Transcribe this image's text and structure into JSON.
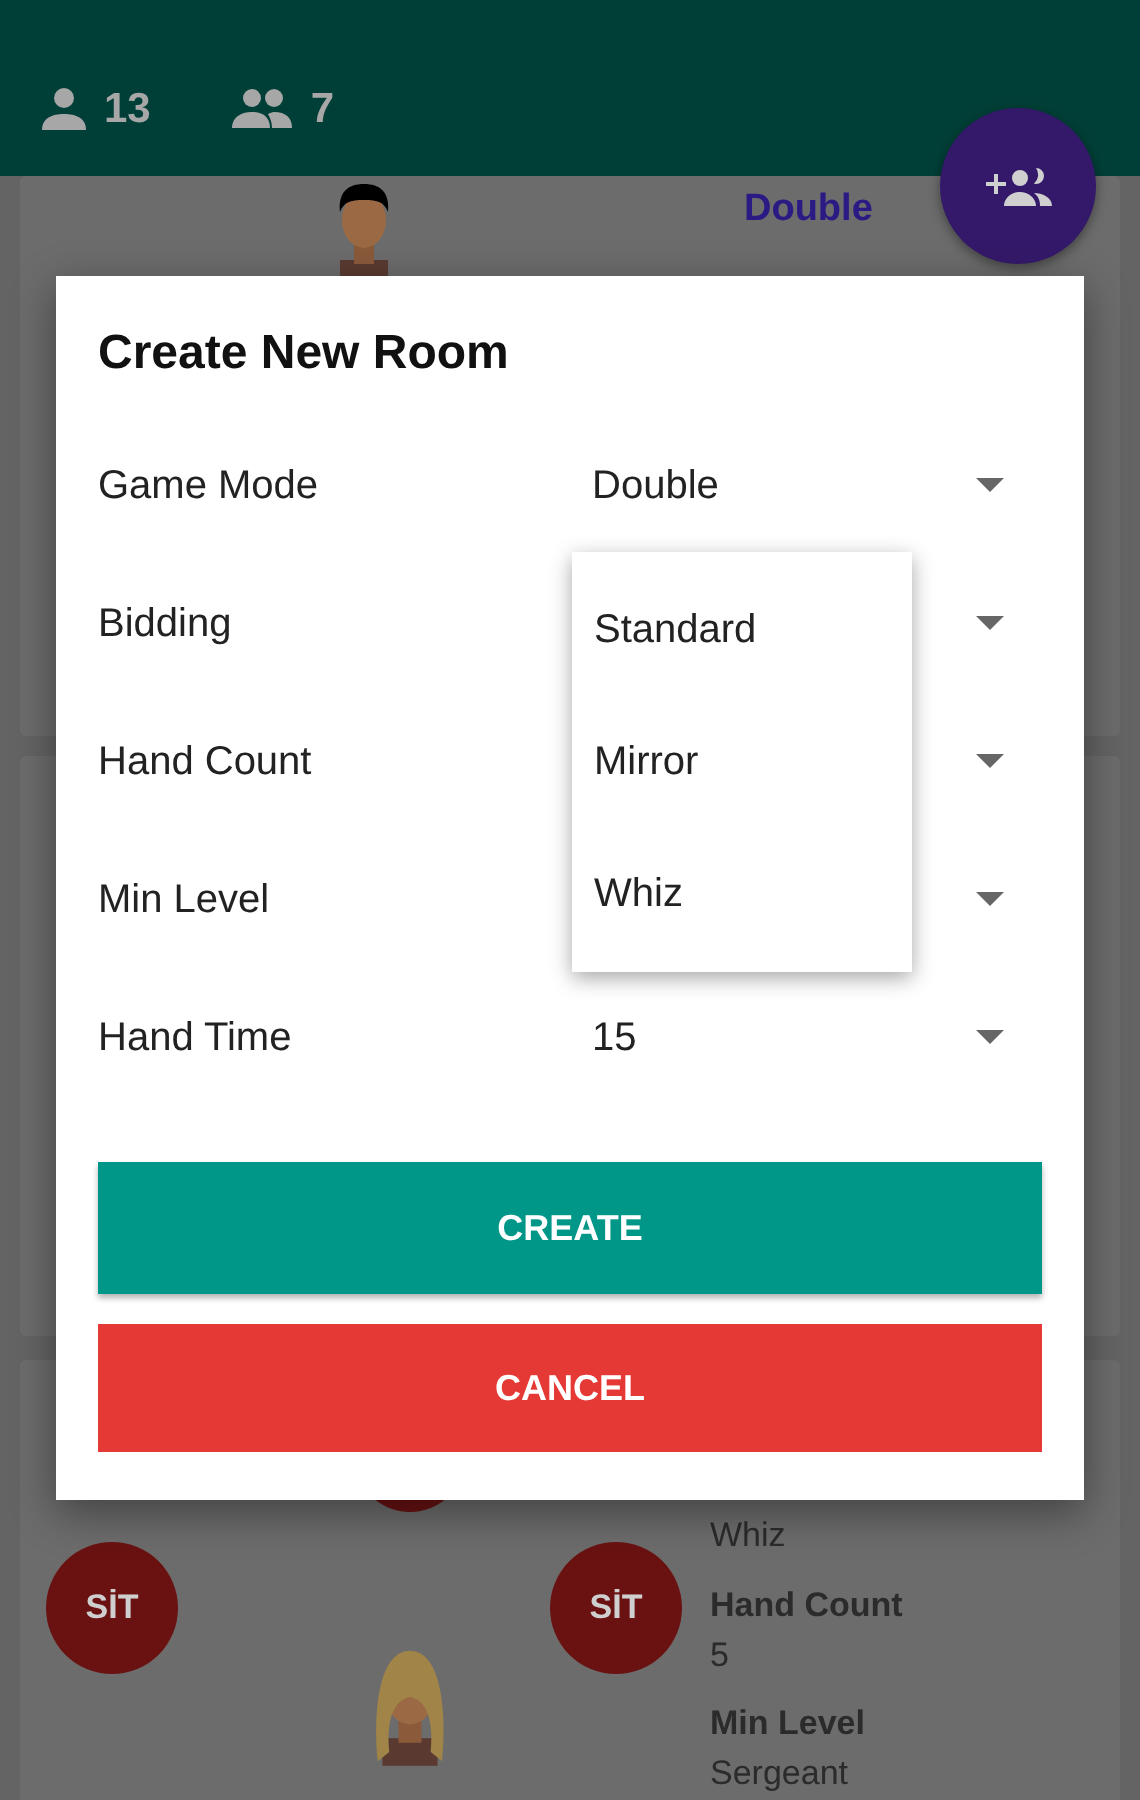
{
  "header": {
    "players_online": "13",
    "groups_online": "7"
  },
  "rooms": [
    {
      "game_mode": "Double"
    },
    {
      "value_only": "Whiz",
      "seats": [
        "SİT",
        "SİT"
      ],
      "details": [
        {
          "label": "Hand Count",
          "value": "5"
        },
        {
          "label": "Min Level",
          "value": "Sergeant"
        }
      ]
    }
  ],
  "dialog": {
    "title": "Create New Room",
    "fields": [
      {
        "label": "Game Mode",
        "value": "Double",
        "expanded": false
      },
      {
        "label": "Bidding",
        "expanded": true,
        "options": [
          "Standard",
          "Mirror",
          "Whiz"
        ]
      },
      {
        "label": "Hand Count",
        "expanded": false
      },
      {
        "label": "Min Level",
        "expanded": false
      },
      {
        "label": "Hand Time",
        "value": "15",
        "expanded": false
      }
    ],
    "buttons": [
      {
        "label": "CREATE",
        "kind": "primary"
      },
      {
        "label": "CANCEL",
        "kind": "danger"
      }
    ]
  }
}
